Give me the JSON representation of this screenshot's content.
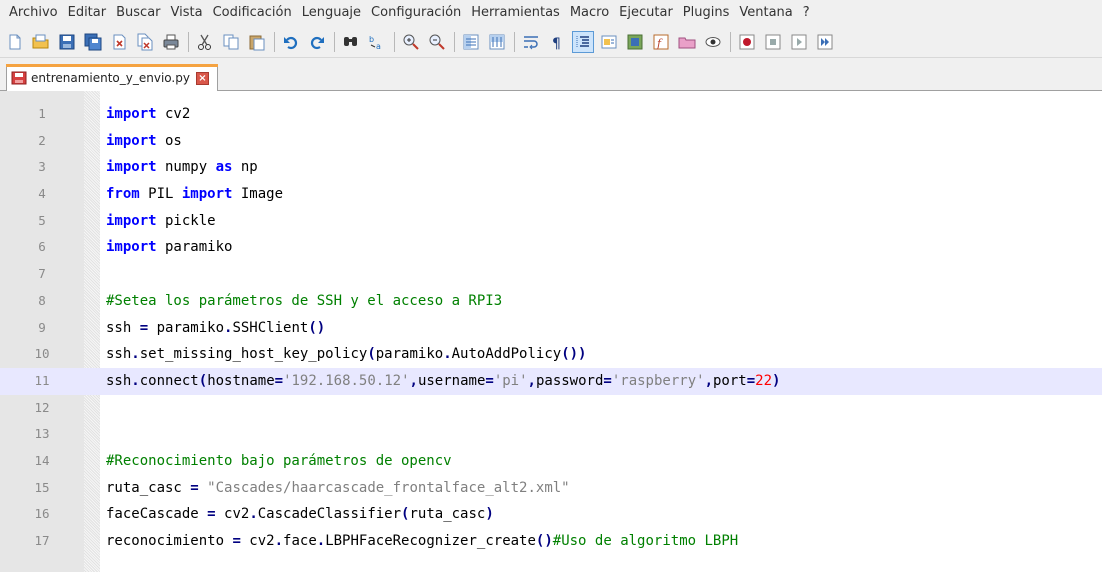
{
  "menu": [
    "Archivo",
    "Editar",
    "Buscar",
    "Vista",
    "Codificación",
    "Lenguaje",
    "Configuración",
    "Herramientas",
    "Macro",
    "Ejecutar",
    "Plugins",
    "Ventana",
    "?"
  ],
  "toolbar_icons": [
    "new-file-icon",
    "open-file-icon",
    "save-icon",
    "save-all-icon",
    "close-icon",
    "close-all-icon",
    "print-icon",
    "cut-icon",
    "copy-icon",
    "paste-icon",
    "undo-icon",
    "redo-icon",
    "find-icon",
    "replace-icon",
    "zoom-in-icon",
    "zoom-out-icon",
    "sync-vertical-icon",
    "sync-horizontal-icon",
    "word-wrap-icon",
    "show-all-characters-icon",
    "indent-guide-icon",
    "user-defined-language-icon",
    "doc-map-icon",
    "function-list-icon",
    "folder-as-workspace-icon",
    "monitoring-icon",
    "record-macro-icon",
    "stop-macro-icon",
    "play-macro-icon",
    "run-macro-multiple-icon"
  ],
  "tab": {
    "filename": "entrenamiento_y_envio.py",
    "close_glyph": "×"
  },
  "editor": {
    "current_line": 11,
    "lines": [
      {
        "n": "1",
        "tokens": [
          {
            "t": "import",
            "c": "kw"
          },
          {
            "t": " cv2",
            "c": ""
          }
        ]
      },
      {
        "n": "2",
        "tokens": [
          {
            "t": "import",
            "c": "kw"
          },
          {
            "t": " os",
            "c": ""
          }
        ]
      },
      {
        "n": "3",
        "tokens": [
          {
            "t": "import",
            "c": "kw"
          },
          {
            "t": " numpy ",
            "c": ""
          },
          {
            "t": "as",
            "c": "kw"
          },
          {
            "t": " np",
            "c": ""
          }
        ]
      },
      {
        "n": "4",
        "tokens": [
          {
            "t": "from",
            "c": "kw"
          },
          {
            "t": " PIL ",
            "c": ""
          },
          {
            "t": "import",
            "c": "kw"
          },
          {
            "t": " Image",
            "c": ""
          }
        ]
      },
      {
        "n": "5",
        "tokens": [
          {
            "t": "import",
            "c": "kw"
          },
          {
            "t": " pickle",
            "c": ""
          }
        ]
      },
      {
        "n": "6",
        "tokens": [
          {
            "t": "import",
            "c": "kw"
          },
          {
            "t": " paramiko",
            "c": ""
          }
        ]
      },
      {
        "n": "7",
        "tokens": []
      },
      {
        "n": "8",
        "tokens": [
          {
            "t": "#Setea los parámetros de SSH y el acceso a RPI3",
            "c": "cmt"
          }
        ]
      },
      {
        "n": "9",
        "tokens": [
          {
            "t": "ssh ",
            "c": ""
          },
          {
            "t": "=",
            "c": "op"
          },
          {
            "t": " paramiko",
            "c": ""
          },
          {
            "t": ".",
            "c": "op"
          },
          {
            "t": "SSHClient",
            "c": ""
          },
          {
            "t": "()",
            "c": "op"
          }
        ]
      },
      {
        "n": "10",
        "tokens": [
          {
            "t": "ssh",
            "c": ""
          },
          {
            "t": ".",
            "c": "op"
          },
          {
            "t": "set_missing_host_key_policy",
            "c": ""
          },
          {
            "t": "(",
            "c": "op"
          },
          {
            "t": "paramiko",
            "c": ""
          },
          {
            "t": ".",
            "c": "op"
          },
          {
            "t": "AutoAddPolicy",
            "c": ""
          },
          {
            "t": "())",
            "c": "op"
          }
        ]
      },
      {
        "n": "11",
        "tokens": [
          {
            "t": "ssh",
            "c": ""
          },
          {
            "t": ".",
            "c": "op"
          },
          {
            "t": "connect",
            "c": ""
          },
          {
            "t": "(",
            "c": "op"
          },
          {
            "t": "hostname",
            "c": ""
          },
          {
            "t": "=",
            "c": "op"
          },
          {
            "t": "'192.168.50.12'",
            "c": "str"
          },
          {
            "t": ",",
            "c": "op"
          },
          {
            "t": "username",
            "c": ""
          },
          {
            "t": "=",
            "c": "op"
          },
          {
            "t": "'pi'",
            "c": "str"
          },
          {
            "t": ",",
            "c": "op"
          },
          {
            "t": "password",
            "c": ""
          },
          {
            "t": "=",
            "c": "op"
          },
          {
            "t": "'raspberry'",
            "c": "str"
          },
          {
            "t": ",",
            "c": "op"
          },
          {
            "t": "port",
            "c": ""
          },
          {
            "t": "=",
            "c": "op"
          },
          {
            "t": "22",
            "c": "num"
          },
          {
            "t": ")",
            "c": "op"
          }
        ]
      },
      {
        "n": "12",
        "tokens": []
      },
      {
        "n": "13",
        "tokens": []
      },
      {
        "n": "14",
        "tokens": [
          {
            "t": "#Reconocimiento bajo parámetros de opencv",
            "c": "cmt"
          }
        ]
      },
      {
        "n": "15",
        "tokens": [
          {
            "t": "ruta_casc ",
            "c": ""
          },
          {
            "t": "=",
            "c": "op"
          },
          {
            "t": " ",
            "c": ""
          },
          {
            "t": "\"Cascades/haarcascade_frontalface_alt2.xml\"",
            "c": "str"
          }
        ]
      },
      {
        "n": "16",
        "tokens": [
          {
            "t": "faceCascade ",
            "c": ""
          },
          {
            "t": "=",
            "c": "op"
          },
          {
            "t": " cv2",
            "c": ""
          },
          {
            "t": ".",
            "c": "op"
          },
          {
            "t": "CascadeClassifier",
            "c": ""
          },
          {
            "t": "(",
            "c": "op"
          },
          {
            "t": "ruta_casc",
            "c": ""
          },
          {
            "t": ")",
            "c": "op"
          }
        ]
      },
      {
        "n": "17",
        "tokens": [
          {
            "t": "reconocimiento ",
            "c": ""
          },
          {
            "t": "=",
            "c": "op"
          },
          {
            "t": " cv2",
            "c": ""
          },
          {
            "t": ".",
            "c": "op"
          },
          {
            "t": "face",
            "c": ""
          },
          {
            "t": ".",
            "c": "op"
          },
          {
            "t": "LBPHFaceRecognizer_create",
            "c": ""
          },
          {
            "t": "()",
            "c": "op"
          },
          {
            "t": "#Uso de algoritmo LBPH",
            "c": "cmt"
          }
        ]
      }
    ]
  }
}
